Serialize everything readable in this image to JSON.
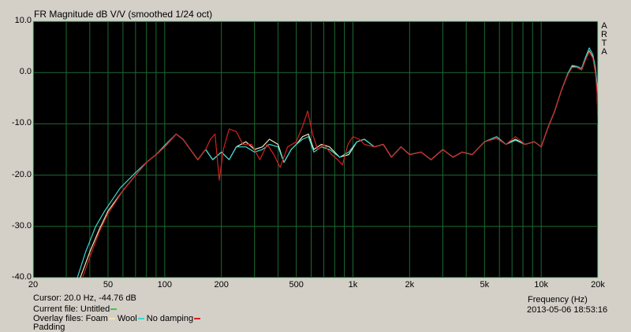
{
  "chart_data": {
    "type": "line",
    "title": "FR Magnitude dB V/V (smoothed 1/24 oct)",
    "xlabel": "Frequency (Hz)",
    "ylabel": "",
    "xscale": "log",
    "xlim": [
      20,
      20000
    ],
    "ylim": [
      -40,
      10
    ],
    "grid": true,
    "yticks": [
      "10.0",
      "0.0",
      "-10.0",
      "-20.0",
      "-30.0",
      "-40.0"
    ],
    "ytick_values": [
      10,
      0,
      -10,
      -20,
      -30,
      -40
    ],
    "xticks": [
      "20",
      "50",
      "100",
      "200",
      "500",
      "1k",
      "2k",
      "5k",
      "10k",
      "20k"
    ],
    "xtick_values": [
      20,
      50,
      100,
      200,
      500,
      1000,
      2000,
      5000,
      10000,
      20000
    ],
    "watermark": "ARTA",
    "series": [
      {
        "name": "Foam",
        "color": "#f2e6b8",
        "points": [
          [
            34,
            -42
          ],
          [
            40,
            -35
          ],
          [
            45,
            -30.5
          ],
          [
            50,
            -27
          ],
          [
            60,
            -23
          ],
          [
            70,
            -20
          ],
          [
            80,
            -17.5
          ],
          [
            90,
            -16
          ],
          [
            100,
            -14.5
          ],
          [
            115,
            -12
          ],
          [
            125,
            -13
          ],
          [
            140,
            -15.5
          ],
          [
            150,
            -17
          ],
          [
            165,
            -15
          ],
          [
            180,
            -17
          ],
          [
            200,
            -15.5
          ],
          [
            220,
            -17
          ],
          [
            240,
            -14.5
          ],
          [
            270,
            -13.5
          ],
          [
            300,
            -15
          ],
          [
            330,
            -14.5
          ],
          [
            360,
            -13
          ],
          [
            400,
            -14
          ],
          [
            430,
            -17.5
          ],
          [
            470,
            -15
          ],
          [
            500,
            -14
          ],
          [
            540,
            -12.5
          ],
          [
            580,
            -12
          ],
          [
            620,
            -15
          ],
          [
            680,
            -14
          ],
          [
            750,
            -14.5
          ],
          [
            850,
            -16.5
          ],
          [
            950,
            -16
          ],
          [
            1050,
            -13.5
          ],
          [
            1150,
            -13
          ],
          [
            1300,
            -14.5
          ],
          [
            1450,
            -14
          ],
          [
            1600,
            -16.5
          ],
          [
            1800,
            -14.5
          ],
          [
            2000,
            -16
          ],
          [
            2300,
            -15.5
          ],
          [
            2600,
            -17
          ],
          [
            3000,
            -15
          ],
          [
            3400,
            -16.5
          ],
          [
            3800,
            -15.5
          ],
          [
            4300,
            -16
          ],
          [
            5000,
            -13.5
          ],
          [
            5800,
            -12.8
          ],
          [
            6500,
            -14
          ],
          [
            7300,
            -13
          ],
          [
            8200,
            -14
          ],
          [
            9200,
            -13.5
          ],
          [
            10000,
            -14.5
          ],
          [
            10800,
            -11
          ],
          [
            11800,
            -7.5
          ],
          [
            12800,
            -3.5
          ],
          [
            13800,
            -0.5
          ],
          [
            14600,
            1.2
          ],
          [
            15500,
            1.0
          ],
          [
            16400,
            0.5
          ],
          [
            17200,
            2.5
          ],
          [
            18000,
            4.2
          ],
          [
            18800,
            3.0
          ],
          [
            19400,
            0.5
          ],
          [
            19800,
            -3
          ],
          [
            20000,
            -8.5
          ]
        ]
      },
      {
        "name": "Wool",
        "color": "#35d8d0",
        "points": [
          [
            33,
            -42
          ],
          [
            38,
            -35
          ],
          [
            43,
            -30
          ],
          [
            48,
            -27
          ],
          [
            58,
            -22.5
          ],
          [
            70,
            -19.5
          ],
          [
            80,
            -17.5
          ],
          [
            90,
            -16
          ],
          [
            100,
            -14.2
          ],
          [
            115,
            -12
          ],
          [
            125,
            -13
          ],
          [
            140,
            -15.5
          ],
          [
            150,
            -17
          ],
          [
            165,
            -15
          ],
          [
            180,
            -17
          ],
          [
            200,
            -15.5
          ],
          [
            220,
            -17
          ],
          [
            240,
            -14.5
          ],
          [
            270,
            -14.5
          ],
          [
            300,
            -15.5
          ],
          [
            330,
            -15
          ],
          [
            360,
            -14
          ],
          [
            400,
            -14.5
          ],
          [
            430,
            -17.5
          ],
          [
            470,
            -15
          ],
          [
            500,
            -14
          ],
          [
            540,
            -13
          ],
          [
            580,
            -12.5
          ],
          [
            620,
            -15.5
          ],
          [
            680,
            -14.5
          ],
          [
            750,
            -15
          ],
          [
            850,
            -16.5
          ],
          [
            950,
            -15.5
          ],
          [
            1050,
            -13.5
          ],
          [
            1150,
            -13
          ],
          [
            1300,
            -14.5
          ],
          [
            1450,
            -14
          ],
          [
            1600,
            -16.5
          ],
          [
            1800,
            -14.5
          ],
          [
            2000,
            -16
          ],
          [
            2300,
            -15.5
          ],
          [
            2600,
            -17
          ],
          [
            3000,
            -15
          ],
          [
            3400,
            -16.5
          ],
          [
            3800,
            -15.5
          ],
          [
            4300,
            -16
          ],
          [
            5000,
            -13.5
          ],
          [
            5800,
            -12.5
          ],
          [
            6500,
            -14
          ],
          [
            7300,
            -13.2
          ],
          [
            8200,
            -14
          ],
          [
            9200,
            -13.5
          ],
          [
            10000,
            -14.5
          ],
          [
            10800,
            -11
          ],
          [
            11800,
            -7.5
          ],
          [
            12800,
            -3.5
          ],
          [
            13800,
            -0.3
          ],
          [
            14600,
            1.4
          ],
          [
            15500,
            1.2
          ],
          [
            16400,
            0.8
          ],
          [
            17200,
            3.0
          ],
          [
            18000,
            4.8
          ],
          [
            18800,
            3.5
          ],
          [
            19400,
            1.0
          ],
          [
            19800,
            -2.5
          ],
          [
            20000,
            -8
          ]
        ]
      },
      {
        "name": "No damping",
        "color": "#d42020",
        "points": [
          [
            35,
            -42
          ],
          [
            40,
            -36
          ],
          [
            45,
            -31
          ],
          [
            50,
            -27.5
          ],
          [
            60,
            -23
          ],
          [
            70,
            -20
          ],
          [
            80,
            -17.5
          ],
          [
            90,
            -16
          ],
          [
            100,
            -14.5
          ],
          [
            115,
            -12
          ],
          [
            125,
            -13
          ],
          [
            140,
            -15.5
          ],
          [
            150,
            -17
          ],
          [
            165,
            -15
          ],
          [
            175,
            -13
          ],
          [
            185,
            -12
          ],
          [
            195,
            -21
          ],
          [
            205,
            -15
          ],
          [
            220,
            -11
          ],
          [
            240,
            -11.5
          ],
          [
            260,
            -14
          ],
          [
            290,
            -14
          ],
          [
            320,
            -17
          ],
          [
            350,
            -14
          ],
          [
            380,
            -16
          ],
          [
            410,
            -18.5
          ],
          [
            450,
            -14.5
          ],
          [
            500,
            -13.5
          ],
          [
            540,
            -10.5
          ],
          [
            575,
            -7.5
          ],
          [
            610,
            -12
          ],
          [
            650,
            -15
          ],
          [
            700,
            -14
          ],
          [
            770,
            -16
          ],
          [
            830,
            -17
          ],
          [
            880,
            -18
          ],
          [
            940,
            -14
          ],
          [
            1000,
            -12.5
          ],
          [
            1080,
            -13
          ],
          [
            1150,
            -14
          ],
          [
            1300,
            -14.5
          ],
          [
            1450,
            -14
          ],
          [
            1600,
            -16.5
          ],
          [
            1800,
            -14.5
          ],
          [
            2000,
            -16
          ],
          [
            2300,
            -15.5
          ],
          [
            2600,
            -17
          ],
          [
            3000,
            -15
          ],
          [
            3400,
            -16.5
          ],
          [
            3800,
            -15.5
          ],
          [
            4300,
            -16
          ],
          [
            5000,
            -13.5
          ],
          [
            5800,
            -12.8
          ],
          [
            6500,
            -14
          ],
          [
            7300,
            -12.5
          ],
          [
            8200,
            -14
          ],
          [
            9200,
            -13.5
          ],
          [
            10000,
            -14.5
          ],
          [
            10800,
            -11
          ],
          [
            11800,
            -7.5
          ],
          [
            12800,
            -3.5
          ],
          [
            13800,
            -0.5
          ],
          [
            14600,
            1.0
          ],
          [
            15500,
            1.0
          ],
          [
            16400,
            0.5
          ],
          [
            17200,
            2.5
          ],
          [
            18000,
            4.0
          ],
          [
            18800,
            2.8
          ],
          [
            19400,
            0
          ],
          [
            19800,
            -4
          ],
          [
            20000,
            -10
          ]
        ]
      }
    ]
  },
  "status": {
    "cursor": "Cursor: 20.0 Hz, -44.76 dB",
    "current_file_label": "Current file: Untitled",
    "current_file_color": "#3cc83c",
    "overlay_label": "Overlay files: Foam",
    "overlay_wool": "Wool",
    "overlay_nodamping": "No damping",
    "overlay_padding": "Padding",
    "datetime": "2013-05-06   18:53:16"
  }
}
